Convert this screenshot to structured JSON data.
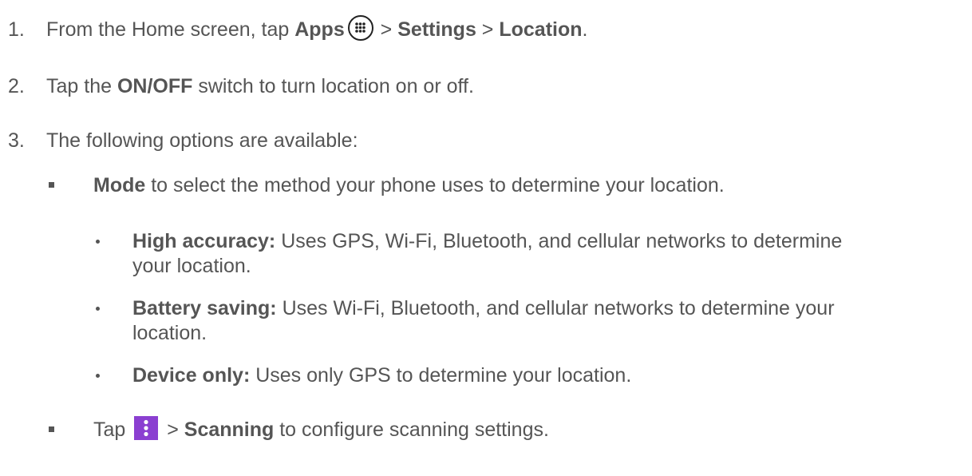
{
  "steps": [
    {
      "number": "1.",
      "text_before": "From the Home screen, tap ",
      "apps": "Apps",
      "sep1": " > ",
      "settings": "Settings",
      "sep2": " > ",
      "location": "Location",
      "end": "."
    },
    {
      "number": "2.",
      "text_before": "Tap the ",
      "onoff": "ON/OFF",
      "text_after": " switch to turn location on or off."
    },
    {
      "number": "3.",
      "text": "The following options are available:"
    }
  ],
  "mode_item": {
    "label": "Mode",
    "text": " to select the method your phone uses to determine your location."
  },
  "mode_options": [
    {
      "label": "High accuracy:",
      "line1": " Uses GPS, Wi-Fi, Bluetooth, and cellular networks to determine",
      "line2": "your location."
    },
    {
      "label": "Battery saving:",
      "line1": " Uses Wi-Fi, Bluetooth, and cellular networks to determine your",
      "line2": "location."
    },
    {
      "label": "Device only:",
      "line1": " Uses only GPS to determine your location."
    }
  ],
  "scan_item": {
    "tap": "Tap ",
    "sep": " > ",
    "label": "Scanning",
    "text": " to configure scanning settings."
  },
  "icons": {
    "apps": "apps-grid-icon",
    "menu": "more-vert-icon",
    "menu_color": "#8b3fd1"
  }
}
